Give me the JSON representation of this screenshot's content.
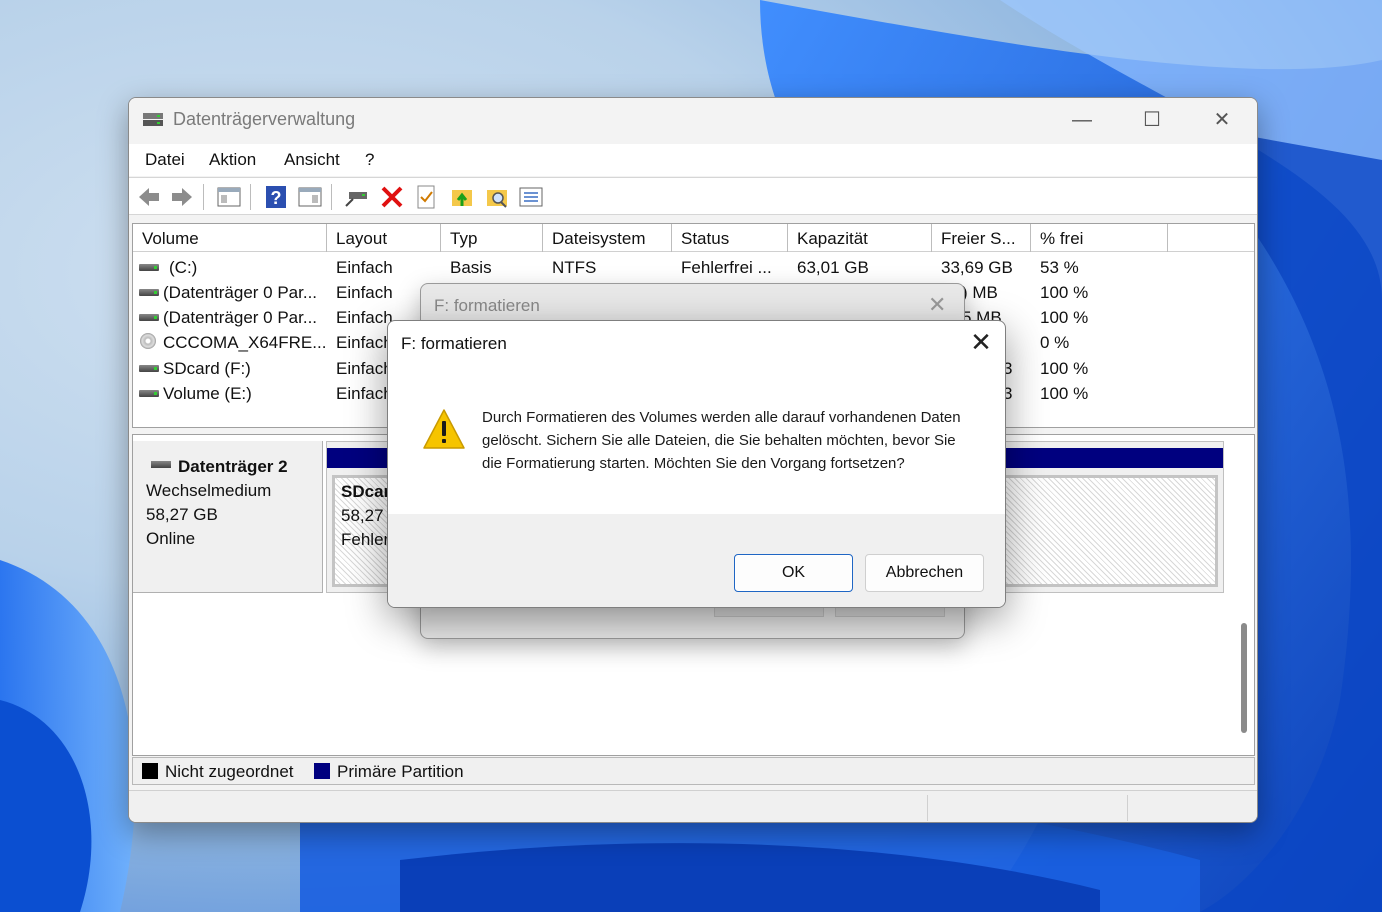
{
  "window": {
    "title": "Datenträgerverwaltung",
    "controls": {
      "minimize": "—",
      "maximize": "☐",
      "close": "✕"
    }
  },
  "menu": [
    "Datei",
    "Aktion",
    "Ansicht",
    "?"
  ],
  "toolbar_icons": [
    "back-icon",
    "forward-icon",
    "console-tree-icon",
    "help-icon",
    "properties-pane-icon",
    "connect-drive-icon",
    "delete-icon",
    "check-icon",
    "open-folder-icon",
    "search-folder-icon",
    "list-view-icon"
  ],
  "columns": [
    "Volume",
    "Layout",
    "Typ",
    "Dateisystem",
    "Status",
    "Kapazität",
    "Freier S...",
    "% frei"
  ],
  "volumes": [
    {
      "icon": "drive",
      "volume": "(C:)",
      "layout": "Einfach",
      "typ": "Basis",
      "dateisystem": "NTFS",
      "status": "Fehlerfrei ...",
      "kapazitaet": "63,01 GB",
      "frei": "33,69 GB",
      "prozent": "53 %"
    },
    {
      "icon": "drive",
      "volume": "(Datenträger 0 Par...",
      "layout": "Einfach",
      "typ": "",
      "dateisystem": "",
      "status": "",
      "kapazitaet": "",
      "frei": ") MB",
      "prozent": "100 %"
    },
    {
      "icon": "drive",
      "volume": "(Datenträger 0 Par...",
      "layout": "Einfach",
      "typ": "",
      "dateisystem": "",
      "status": "",
      "kapazitaet": "",
      "frei": "5 MB",
      "prozent": "100 %"
    },
    {
      "icon": "cd",
      "volume": "CCCOMA_X64FRE...",
      "layout": "Einfach",
      "typ": "",
      "dateisystem": "",
      "status": "",
      "kapazitaet": "",
      "frei": "",
      "prozent": "0 %"
    },
    {
      "icon": "drive",
      "volume": "SDcard (F:)",
      "layout": "Einfach",
      "typ": "",
      "dateisystem": "",
      "status": "",
      "kapazitaet": "",
      "frei": "3",
      "prozent": "100 %"
    },
    {
      "icon": "drive",
      "volume": "Volume (E:)",
      "layout": "Einfach",
      "typ": "",
      "dateisystem": "",
      "status": "",
      "kapazitaet": "",
      "frei": "3",
      "prozent": "100 %"
    }
  ],
  "disk": {
    "name": "Datenträger 2",
    "type": "Wechselmedium",
    "size": "58,27 GB",
    "state": "Online",
    "partition": {
      "name": "SDcar",
      "size": "58,27 (",
      "status": "Fehler"
    }
  },
  "legend": [
    {
      "label": "Nicht zugeordnet",
      "color": "#000000"
    },
    {
      "label": "Primäre Partition",
      "color": "#00007f"
    }
  ],
  "background_dialog": {
    "title": "F: formatieren",
    "close": "✕"
  },
  "dialog": {
    "title": "F: formatieren",
    "close": "✕",
    "message": "Durch Formatieren des Volumes werden alle darauf vorhandenen Daten gelöscht. Sichern Sie alle Dateien, die Sie behalten möchten, bevor Sie die Formatierung starten. Möchten Sie den Vorgang fortsetzen?",
    "ok": "OK",
    "cancel": "Abbrechen",
    "icon": "warning-icon"
  },
  "colors": {
    "accent": "#1f66c4",
    "primary_partition": "#00007f",
    "warning": "#f6c400"
  }
}
